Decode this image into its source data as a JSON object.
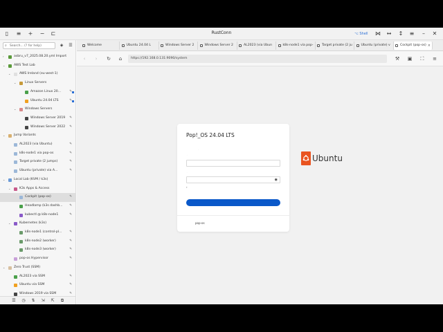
{
  "app": {
    "title": "RustConn",
    "shell_label": "Shell"
  },
  "search": {
    "placeholder": "Search... (? for help)"
  },
  "tree": [
    {
      "label": "asbru_v7_2025.08.20.yml Import",
      "level": 0,
      "arrow": "›",
      "color": "#5a9a3a"
    },
    {
      "label": "AWS Test Lab",
      "level": 0,
      "arrow": "⌄",
      "color": "#5a9a3a"
    },
    {
      "label": "AWS Ireland (eu-west-1)",
      "level": 1,
      "arrow": "⌄",
      "color": "#e0e0e0"
    },
    {
      "label": "Linux Servers",
      "level": 2,
      "arrow": "⌄",
      "color": "#c79a3a"
    },
    {
      "label": "Amazon Linux 20...",
      "level": 3,
      "arrow": "",
      "color": "#4aa04a",
      "pen": true,
      "dot": true
    },
    {
      "label": "Ubuntu 24.04 LTS",
      "level": 3,
      "arrow": "",
      "color": "#f0a020",
      "pen": true,
      "dot": true
    },
    {
      "label": "Windows Servers",
      "level": 2,
      "arrow": "⌄",
      "color": "#d88a8a"
    },
    {
      "label": "Windows Server 2019",
      "level": 3,
      "arrow": "",
      "color": "#444",
      "pen": true
    },
    {
      "label": "Windows Server 2022",
      "level": 3,
      "arrow": "",
      "color": "#444",
      "pen": true
    },
    {
      "label": "Jump Variants",
      "level": 0,
      "arrow": "⌄",
      "color": "#d8b070"
    },
    {
      "label": "AL2023 (via Ubuntu)",
      "level": 1,
      "arrow": "",
      "color": "#9cb8d8",
      "pen": true
    },
    {
      "label": "k8s-node1 via pop-os",
      "level": 1,
      "arrow": "",
      "color": "#9cb8d8",
      "pen": true
    },
    {
      "label": "Target private (2 jumps)",
      "level": 1,
      "arrow": "",
      "color": "#9cb8d8",
      "pen": true
    },
    {
      "label": "Ubuntu (private) via A...",
      "level": 1,
      "arrow": "",
      "color": "#9cb8d8",
      "pen": true
    },
    {
      "label": "Local Lab (KVM / k3s)",
      "level": 0,
      "arrow": "⌄",
      "color": "#6a9ad8"
    },
    {
      "label": "K3s Apps & Access",
      "level": 1,
      "arrow": "⌄",
      "color": "#c85a8a"
    },
    {
      "label": "Cockpit (pop-os)",
      "level": 2,
      "arrow": "",
      "color": "#9cb8d8",
      "pen": true,
      "selected": true
    },
    {
      "label": "Headlamp (k3s dashb...",
      "level": 2,
      "arrow": "",
      "color": "#4aa04a",
      "pen": true
    },
    {
      "label": "kubectl @ k8s-node1",
      "level": 2,
      "arrow": "",
      "color": "#8a5ac8",
      "pen": true
    },
    {
      "label": "Kubernetes (k3s)",
      "level": 1,
      "arrow": "⌄",
      "color": "#8a5ac8"
    },
    {
      "label": "k8s-node1 (control-pl...",
      "level": 2,
      "arrow": "",
      "color": "#6a9a6a",
      "pen": true
    },
    {
      "label": "k8s-node2 (worker)",
      "level": 2,
      "arrow": "",
      "color": "#6a9a6a",
      "pen": true
    },
    {
      "label": "k8s-node3 (worker)",
      "level": 2,
      "arrow": "",
      "color": "#6a9a6a",
      "pen": true
    },
    {
      "label": "pop-os Hypervisor",
      "level": 1,
      "arrow": "",
      "color": "#c8a0d8",
      "pen": true
    },
    {
      "label": "Zero Trust (SSM)",
      "level": 0,
      "arrow": "⌄",
      "color": "#d8c0a0"
    },
    {
      "label": "AL2023 via SSM",
      "level": 1,
      "arrow": "",
      "color": "#4aa04a",
      "pen": true
    },
    {
      "label": "Ubuntu via SSM",
      "level": 1,
      "arrow": "",
      "color": "#f0a020",
      "pen": true
    },
    {
      "label": "Windows 2019 via SSM",
      "level": 1,
      "arrow": "",
      "color": "#444",
      "pen": true
    }
  ],
  "tabs": [
    {
      "label": "Welcome"
    },
    {
      "label": "Ubuntu 24.04 L"
    },
    {
      "label": "Windows Server 2"
    },
    {
      "label": "Windows Server 2"
    },
    {
      "label": "AL2023 (via Ubun"
    },
    {
      "label": "k8s-node1 via pop-"
    },
    {
      "label": "Target private (2 ju"
    },
    {
      "label": "Ubuntu (private) v"
    },
    {
      "label": "Cockpit (pop-os)",
      "active": true
    }
  ],
  "url": "https://192.168.0.131:9090/system",
  "login": {
    "title": "Pop!_OS 24.04 LTS",
    "host": "pop-os"
  },
  "brand": {
    "name": "Ubuntu",
    "color": "#e95420"
  },
  "colors": {
    "accent": "#0a58c9",
    "selection": "#dedede"
  }
}
